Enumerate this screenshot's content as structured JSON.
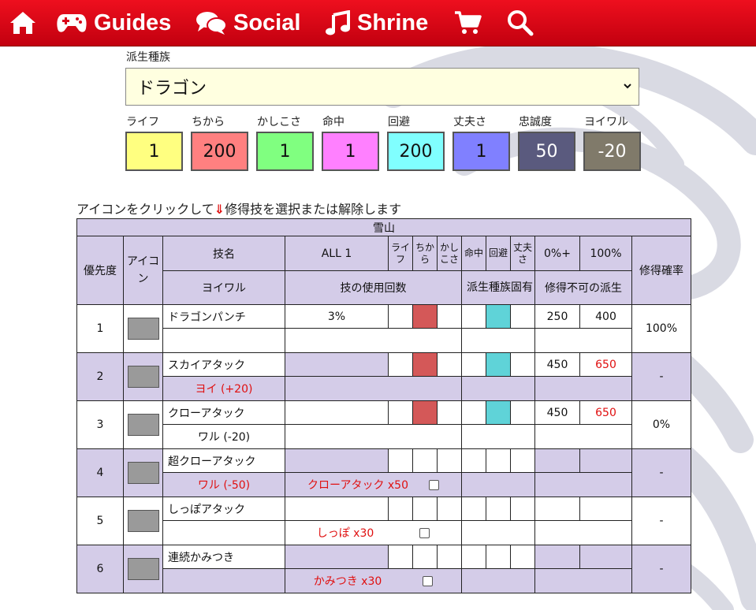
{
  "nav": {
    "home_icon": "home-icon",
    "items": [
      {
        "label": "Guides",
        "icon": "gamepad-icon"
      },
      {
        "label": "Social",
        "icon": "chat-icon"
      },
      {
        "label": "Shrine",
        "icon": "music-note-icon"
      }
    ],
    "cart_icon": "cart-icon",
    "search_icon": "search-icon",
    "bar_color": "#d8041a"
  },
  "form": {
    "species_label": "派生種族",
    "species_value": "ドラゴン",
    "select_bg": "#ffffe0"
  },
  "stats": [
    {
      "label": "ライフ",
      "value": "1",
      "color": "#ffff80"
    },
    {
      "label": "ちから",
      "value": "200",
      "color": "#ff8080"
    },
    {
      "label": "かしこさ",
      "value": "1",
      "color": "#80ff80"
    },
    {
      "label": "命中",
      "value": "1",
      "color": "#ff80ff"
    },
    {
      "label": "回避",
      "value": "200",
      "color": "#80ffff"
    },
    {
      "label": "丈夫さ",
      "value": "1",
      "color": "#8080ff"
    },
    {
      "label": "忠誠度",
      "value": "50",
      "color": "#5a5a7e"
    },
    {
      "label": "ヨイワル",
      "value": "-20",
      "color": "#807a6a"
    }
  ],
  "instruction": {
    "before": "アイコンをクリックして",
    "arrow": "⇓",
    "after": "修得技を選択または解除します"
  },
  "table": {
    "title": "雪山",
    "headers": {
      "priority": "優先度",
      "icon": "アイコン",
      "name": "技名",
      "all": "ALL 1",
      "life": "ライフ",
      "power": "ちから",
      "wisdom": "かしこさ",
      "accuracy": "命中",
      "evasion": "回避",
      "toughness": "丈夫さ",
      "pct0": "0%+",
      "pct100": "100%",
      "rate": "修得確率",
      "alignment": "ヨイワル",
      "usage": "技の使用回数",
      "species_unique": "派生種族固有",
      "not_learnable": "修得不可の派生"
    },
    "rows": [
      {
        "priority": "1",
        "icon": "dragon-punch-icon",
        "name": "ドラゴンパンチ",
        "all": "3%",
        "v0": "250",
        "v100": "400",
        "rate": "100%",
        "alignment": "",
        "usage": ""
      },
      {
        "priority": "2",
        "icon": "sky-attack-icon",
        "name": "スカイアタック",
        "all": "",
        "v0": "450",
        "v100": "650",
        "rate": "-",
        "alignment": "ヨイ (+20)",
        "usage": ""
      },
      {
        "priority": "3",
        "icon": "claw-attack-icon",
        "name": "クローアタック",
        "all": "",
        "v0": "450",
        "v100": "650",
        "rate": "0%",
        "alignment": "ワル (-20)",
        "usage": ""
      },
      {
        "priority": "4",
        "icon": "super-claw-attack-icon",
        "name": "超クローアタック",
        "all": "",
        "v0": "",
        "v100": "",
        "rate": "-",
        "alignment": "ワル (-50)",
        "usage": "クローアタック x50"
      },
      {
        "priority": "5",
        "icon": "tail-attack-icon",
        "name": "しっぽアタック",
        "all": "",
        "v0": "",
        "v100": "",
        "rate": "-",
        "alignment": "",
        "usage": "しっぽ x30"
      },
      {
        "priority": "6",
        "icon": "consecutive-bite-icon",
        "name": "連続かみつき",
        "all": "",
        "v0": "",
        "v100": "",
        "rate": "-",
        "alignment": "",
        "usage": "かみつき x30"
      }
    ],
    "colors": {
      "header": "#d4cce8",
      "power_mark": "#d45858",
      "evasion_mark": "#5fd3d8"
    }
  }
}
